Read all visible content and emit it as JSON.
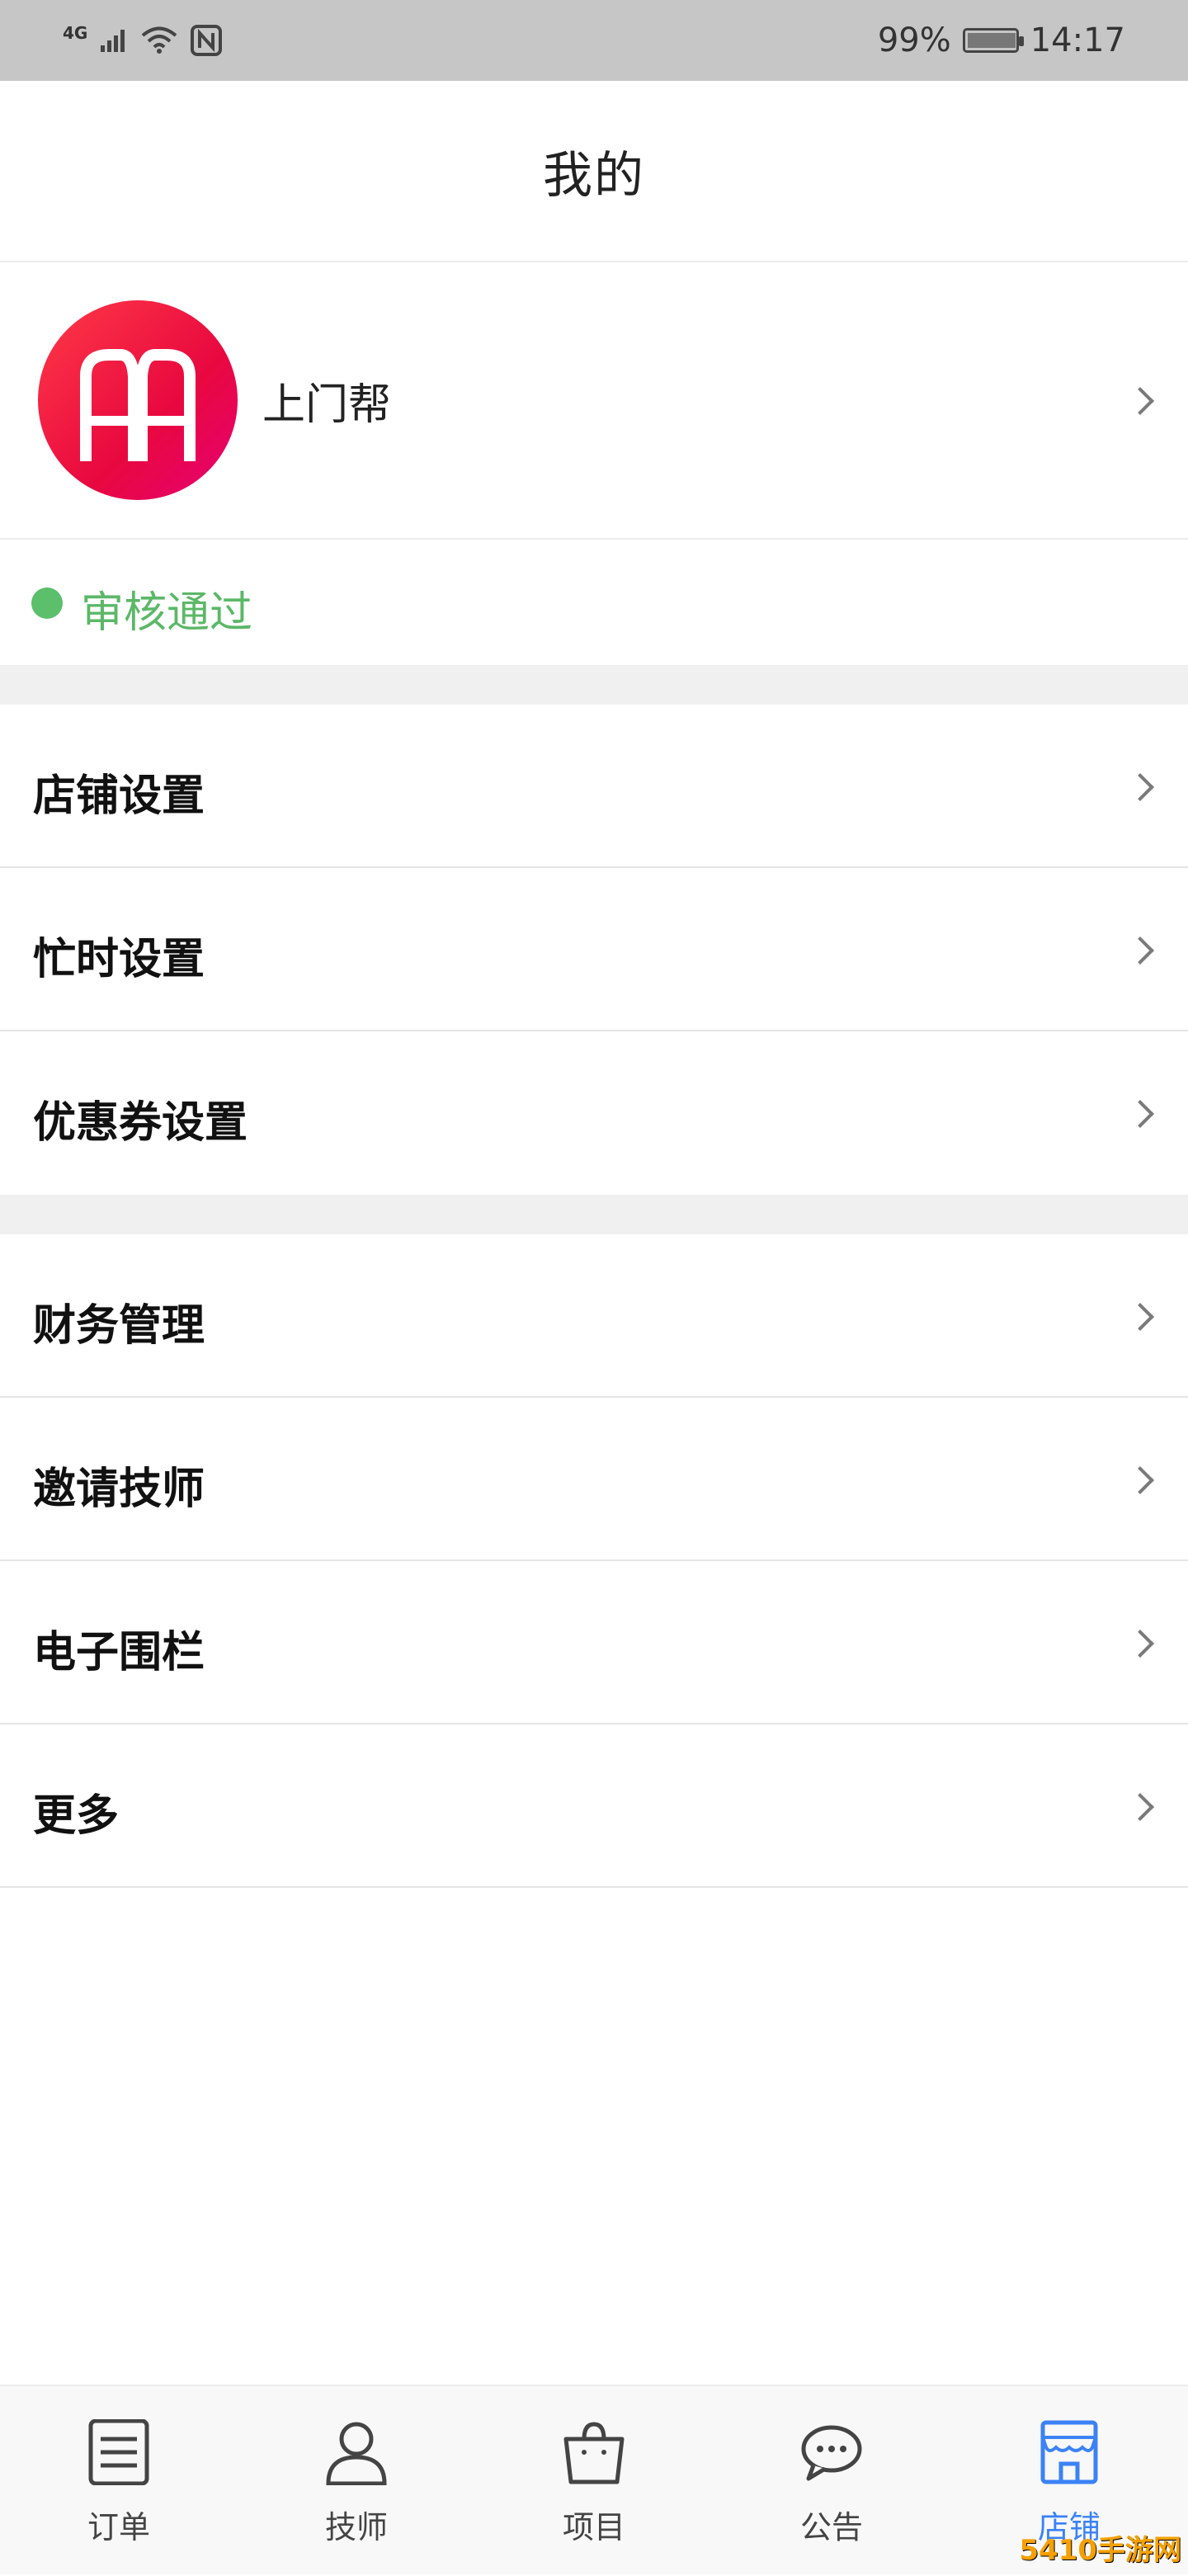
{
  "status_bar": {
    "network": "4G",
    "battery": "99%",
    "time": "14:17"
  },
  "header": {
    "title": "我的"
  },
  "profile": {
    "name": "上门帮"
  },
  "verify": {
    "status_text": "审核通过",
    "status_color": "#5bb867"
  },
  "menu": {
    "group1": [
      {
        "label": "店铺设置"
      },
      {
        "label": "忙时设置"
      },
      {
        "label": "优惠券设置"
      }
    ],
    "group2": [
      {
        "label": "财务管理"
      },
      {
        "label": "邀请技师"
      },
      {
        "label": "电子围栏"
      },
      {
        "label": "更多"
      }
    ]
  },
  "tabbar": {
    "tabs": [
      {
        "label": "订单",
        "icon": "order-icon"
      },
      {
        "label": "技师",
        "icon": "person-icon"
      },
      {
        "label": "项目",
        "icon": "bag-icon"
      },
      {
        "label": "公告",
        "icon": "chat-icon"
      },
      {
        "label": "店铺",
        "icon": "store-icon",
        "active": true
      }
    ],
    "active_color": "#3b82f6"
  },
  "watermark": "5410手游网"
}
